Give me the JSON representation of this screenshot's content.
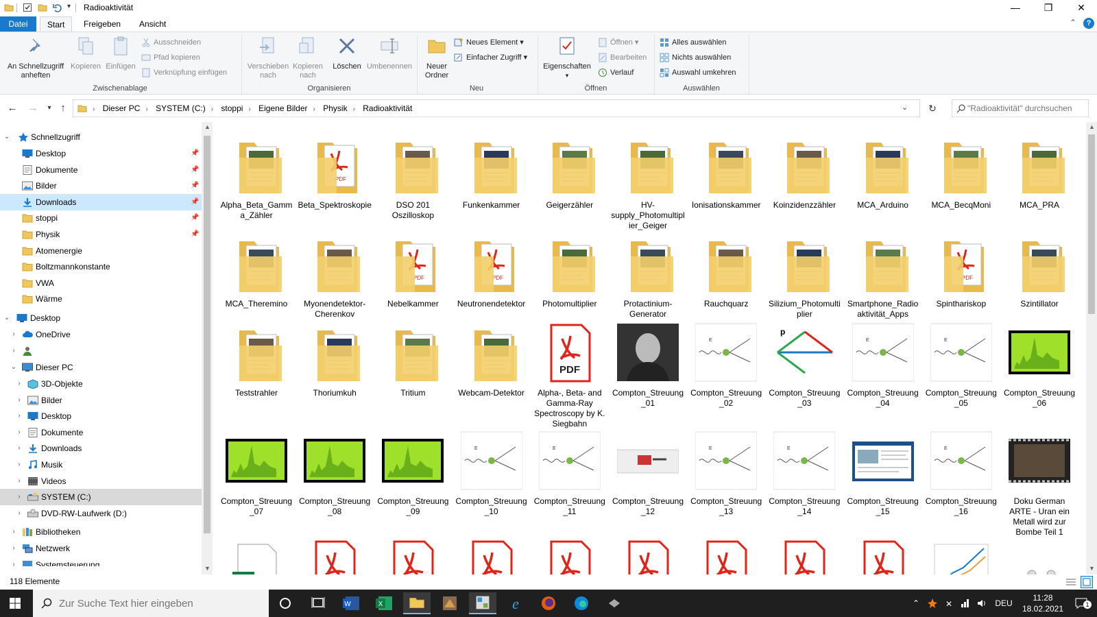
{
  "window": {
    "title": "Radioaktivität",
    "minimize": "—",
    "maximize": "❐",
    "close": "✕",
    "help": "?"
  },
  "ribbon_tabs": [
    {
      "label": "Datei"
    },
    {
      "label": "Start"
    },
    {
      "label": "Freigeben"
    },
    {
      "label": "Ansicht"
    }
  ],
  "ribbon": {
    "pin_quick": "An Schnellzugriff anheften",
    "copy": "Kopieren",
    "paste": "Einfügen",
    "cut": "Ausschneiden",
    "copy_path": "Pfad kopieren",
    "paste_shortcut": "Verknüpfung einfügen",
    "group_clipboard": "Zwischenablage",
    "move_to": "Verschieben nach",
    "copy_to": "Kopieren nach",
    "delete": "Löschen",
    "rename": "Umbenennen",
    "group_organize": "Organisieren",
    "new_folder": "Neuer Ordner",
    "new_item": "Neues Element",
    "easy_access": "Einfacher Zugriff",
    "group_new": "Neu",
    "properties": "Eigenschaften",
    "open": "Öffnen",
    "edit": "Bearbeiten",
    "history": "Verlauf",
    "group_open": "Öffnen",
    "select_all": "Alles auswählen",
    "select_none": "Nichts auswählen",
    "invert_selection": "Auswahl umkehren",
    "group_select": "Auswählen"
  },
  "address": {
    "crumbs": [
      "Dieser PC",
      "SYSTEM (C:)",
      "stoppi",
      "Eigene Bilder",
      "Physik",
      "Radioaktivität"
    ],
    "search_placeholder": "\"Radioaktivität\" durchsuchen"
  },
  "navpane": {
    "quick_access": "Schnellzugriff",
    "quick_items": [
      {
        "label": "Desktop",
        "icon": "desktop-icon"
      },
      {
        "label": "Dokumente",
        "icon": "documents-icon"
      },
      {
        "label": "Bilder",
        "icon": "pictures-icon"
      },
      {
        "label": "Downloads",
        "icon": "downloads-icon"
      },
      {
        "label": "stoppi",
        "icon": "folder-icon"
      },
      {
        "label": "Physik",
        "icon": "folder-icon"
      },
      {
        "label": "Atomenergie",
        "icon": "folder-icon"
      },
      {
        "label": "Boltzmannkonstante",
        "icon": "folder-icon"
      },
      {
        "label": "VWA",
        "icon": "folder-icon"
      },
      {
        "label": "Wärme",
        "icon": "folder-icon"
      }
    ],
    "desktop": "Desktop",
    "onedrive": "OneDrive",
    "this_pc": "Dieser PC",
    "pc_items": [
      {
        "label": "3D-Objekte"
      },
      {
        "label": "Bilder"
      },
      {
        "label": "Desktop"
      },
      {
        "label": "Dokumente"
      },
      {
        "label": "Downloads"
      },
      {
        "label": "Musik"
      },
      {
        "label": "Videos"
      },
      {
        "label": "SYSTEM (C:)"
      },
      {
        "label": "DVD-RW-Laufwerk (D:)"
      }
    ],
    "libraries": "Bibliotheken",
    "network": "Netzwerk",
    "control_panel": "Systemsteuerung"
  },
  "items": [
    {
      "label": "Alpha_Beta_Gamma_Zähler",
      "kind": "folder"
    },
    {
      "label": "Beta_Spektroskopie",
      "kind": "folder-pdf"
    },
    {
      "label": "DSO 201 Oszilloskop",
      "kind": "folder"
    },
    {
      "label": "Funkenkammer",
      "kind": "folder"
    },
    {
      "label": "Geigerzähler",
      "kind": "folder"
    },
    {
      "label": "HV-supply_Photomultiplier_Geiger",
      "kind": "folder"
    },
    {
      "label": "Ionisationskammer",
      "kind": "folder"
    },
    {
      "label": "Koinzidenzzähler",
      "kind": "folder"
    },
    {
      "label": "MCA_Arduino",
      "kind": "folder"
    },
    {
      "label": "MCA_BecqMoni",
      "kind": "folder"
    },
    {
      "label": "MCA_PRA",
      "kind": "folder"
    },
    {
      "label": "MCA_Theremino",
      "kind": "folder"
    },
    {
      "label": "Myonendetektor-Cherenkov",
      "kind": "folder"
    },
    {
      "label": "Nebelkammer",
      "kind": "folder-pdf"
    },
    {
      "label": "Neutronendetektor",
      "kind": "folder-pdf"
    },
    {
      "label": "Photomultiplier",
      "kind": "folder"
    },
    {
      "label": "Protactinium-Generator",
      "kind": "folder"
    },
    {
      "label": "Rauchquarz",
      "kind": "folder"
    },
    {
      "label": "Silizium_Photomultiplier",
      "kind": "folder"
    },
    {
      "label": "Smartphone_Radioaktivität_Apps",
      "kind": "folder"
    },
    {
      "label": "Spinthariskop",
      "kind": "folder-pdf"
    },
    {
      "label": "Szintillator",
      "kind": "folder"
    },
    {
      "label": "Teststrahler",
      "kind": "folder"
    },
    {
      "label": "Thoriumkuh",
      "kind": "folder"
    },
    {
      "label": "Tritium",
      "kind": "folder"
    },
    {
      "label": "Webcam-Detektor",
      "kind": "folder"
    },
    {
      "label": "Alpha-, Beta- and Gamma-Ray Spectroscopy by K. Siegbahn",
      "kind": "pdf"
    },
    {
      "label": "Compton_Streuung_01",
      "kind": "photo"
    },
    {
      "label": "Compton_Streuung_02",
      "kind": "diagram"
    },
    {
      "label": "Compton_Streuung_03",
      "kind": "vector"
    },
    {
      "label": "Compton_Streuung_04",
      "kind": "diagram"
    },
    {
      "label": "Compton_Streuung_05",
      "kind": "diagram"
    },
    {
      "label": "Compton_Streuung_06",
      "kind": "spectrum"
    },
    {
      "label": "Compton_Streuung_07",
      "kind": "spectrum"
    },
    {
      "label": "Compton_Streuung_08",
      "kind": "spectrum"
    },
    {
      "label": "Compton_Streuung_09",
      "kind": "spectrum"
    },
    {
      "label": "Compton_Streuung_10",
      "kind": "diagram"
    },
    {
      "label": "Compton_Streuung_11",
      "kind": "diagram"
    },
    {
      "label": "Compton_Streuung_12",
      "kind": "photo-small"
    },
    {
      "label": "Compton_Streuung_13",
      "kind": "diagram"
    },
    {
      "label": "Compton_Streuung_14",
      "kind": "diagram"
    },
    {
      "label": "Compton_Streuung_15",
      "kind": "screen"
    },
    {
      "label": "Compton_Streuung_16",
      "kind": "diagram"
    },
    {
      "label": "Doku German ARTE - Uran ein Metall wird zur Bombe Teil 1",
      "kind": "video"
    },
    {
      "label": "",
      "kind": "excel"
    },
    {
      "label": "",
      "kind": "pdf"
    },
    {
      "label": "",
      "kind": "pdf"
    },
    {
      "label": "",
      "kind": "pdf"
    },
    {
      "label": "",
      "kind": "pdf"
    },
    {
      "label": "",
      "kind": "pdf"
    },
    {
      "label": "",
      "kind": "pdf"
    },
    {
      "label": "",
      "kind": "pdf"
    },
    {
      "label": "",
      "kind": "pdf"
    },
    {
      "label": "",
      "kind": "chart"
    },
    {
      "label": "",
      "kind": "molecule"
    }
  ],
  "status": {
    "count": "118 Elemente"
  },
  "taskbar": {
    "search_placeholder": "Zur Suche Text hier eingeben",
    "lang": "DEU",
    "time": "11:28",
    "date": "18.02.2021",
    "notif": "1"
  },
  "colors": {
    "accent": "#1979ca",
    "folder": "#f0c75e",
    "pdf_red": "#e2231a"
  }
}
